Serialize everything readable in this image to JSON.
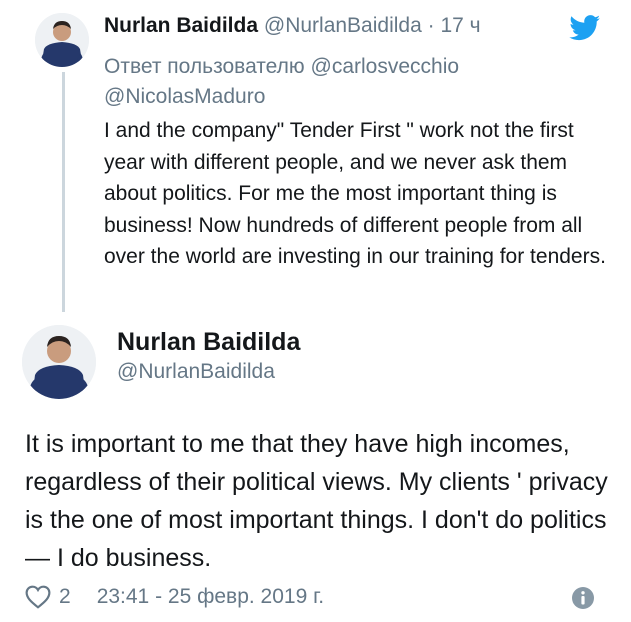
{
  "reply_tweet": {
    "name": "Nurlan Baidilda",
    "handle": "@NurlanBaidilda",
    "separator": "·",
    "time": "17 ч",
    "reply_prefix": "Ответ пользователю",
    "mention_1": "@carlosvecchio",
    "mention_2": "@NicolasMaduro",
    "text": "I and the company\" Tender First \" work not the first year with different people, and we never ask them about politics. For me the most important thing is business! Now hundreds of different people from all over the world are investing in our training for tenders."
  },
  "main_tweet": {
    "name": "Nurlan Baidilda",
    "handle": "@NurlanBaidilda",
    "text": "It is important to me that they have high incomes, regardless of their political views. My clients ' privacy is the one of most important things. I don't do politics — I do business.",
    "likes": "2",
    "timestamp": "23:41 - 25 февр. 2019 г."
  },
  "icons": {
    "brand": "twitter-bird-icon",
    "like": "heart-icon",
    "info": "info-icon"
  },
  "colors": {
    "accent": "#1da1f2",
    "secondary_text": "#657786",
    "primary_text": "#14171a",
    "thread_line": "#ccd6dd"
  }
}
